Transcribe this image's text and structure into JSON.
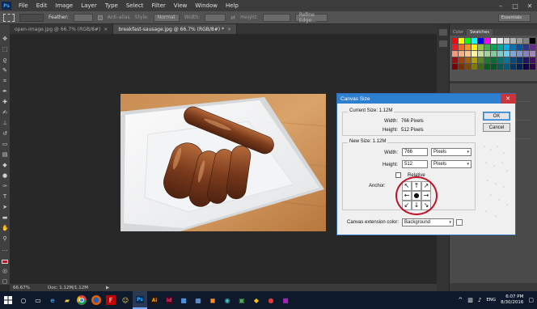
{
  "menu": {
    "app_badge": "Ps",
    "items": [
      "File",
      "Edit",
      "Image",
      "Layer",
      "Type",
      "Select",
      "Filter",
      "View",
      "Window",
      "Help"
    ],
    "window_controls": [
      "minimize",
      "maximize",
      "close"
    ]
  },
  "options_bar": {
    "feather_label": "Feather:",
    "anti_alias_label": "Anti-alias",
    "style_label": "Style:",
    "style_value": "Normal",
    "width_label": "Width:",
    "height_label": "Height:",
    "refine_edge": "Refine Edge...",
    "workspace": "Essentials"
  },
  "tabs": [
    {
      "label": "open-image.jpg @ 66.7% (RGB/8#)",
      "active": false
    },
    {
      "label": "breakfast-sausage.jpg @ 66.7% (RGB/8#) *",
      "active": true
    }
  ],
  "status_bar": {
    "zoom": "66.67%",
    "doc": "Doc: 1.12M/1.12M"
  },
  "swatches_panel": {
    "tabs": [
      "Color",
      "Swatches"
    ],
    "active_tab": "Swatches",
    "colors": [
      "#ff0000",
      "#ffff00",
      "#00ff00",
      "#00ffff",
      "#0000ff",
      "#ff00ff",
      "#ffffff",
      "#e6e6e6",
      "#cccccc",
      "#b3b3b3",
      "#999999",
      "#808080",
      "#000000",
      "#ed1c24",
      "#f26522",
      "#f7941d",
      "#fff200",
      "#8dc63f",
      "#39b54a",
      "#00a651",
      "#00a99d",
      "#00aeef",
      "#0072bc",
      "#0054a6",
      "#2e3192",
      "#662d91",
      "#f69679",
      "#f9ad81",
      "#fdc689",
      "#fff79a",
      "#c4df9b",
      "#a3d39c",
      "#82ca9c",
      "#7accc8",
      "#6dcff6",
      "#7ea7d8",
      "#8493ca",
      "#8882be",
      "#a187be",
      "#9e0b0f",
      "#a0410d",
      "#a36209",
      "#aba000",
      "#598527",
      "#1a7b30",
      "#007236",
      "#00746b",
      "#0076a3",
      "#004b80",
      "#003471",
      "#1b1464",
      "#440e62",
      "#790000",
      "#7b2e00",
      "#7d4900",
      "#827b00",
      "#406618",
      "#005e20",
      "#005826",
      "#005952",
      "#005b7f",
      "#003663",
      "#002157",
      "#0d004c",
      "#32004b"
    ]
  },
  "dialog": {
    "title": "Canvas Size",
    "close": "✕",
    "current_size_label": "Current Size: 1.12M",
    "current_width_label": "Width:",
    "current_width_value": "766 Pixels",
    "current_height_label": "Height:",
    "current_height_value": "512 Pixels",
    "new_size_label": "New Size: 1.12M",
    "width_label": "Width:",
    "width_value": "766",
    "width_unit": "Pixels",
    "height_label": "Height:",
    "height_value": "512",
    "height_unit": "Pixels",
    "relative_label": "Relative",
    "relative_checked": false,
    "anchor_label": "Anchor:",
    "anchor_glyphs": [
      "↖",
      "↑",
      "↗",
      "←",
      "●",
      "→",
      "↙",
      "↓",
      "↘"
    ],
    "extension_label": "Canvas extension color:",
    "extension_value": "Background",
    "ok": "OK",
    "cancel": "Cancel"
  },
  "taskbar": {
    "apps": [
      "file-explorer",
      "edge",
      "chrome",
      "firefox",
      "filezilla",
      "smiley",
      "photoshop",
      "illustrator",
      "indesign",
      "app-blue",
      "app-grid",
      "app-orange",
      "app-teal",
      "app-green",
      "app-yellow",
      "app-red",
      "app-purple"
    ],
    "active_app": "photoshop",
    "language": "ENG",
    "time": "6:07 PM",
    "date": "8/30/2016"
  },
  "colors": {
    "accent": "#2d7fd0",
    "highlight_ring": "#c0122a",
    "photoshop_blue": "#31a8ff"
  }
}
